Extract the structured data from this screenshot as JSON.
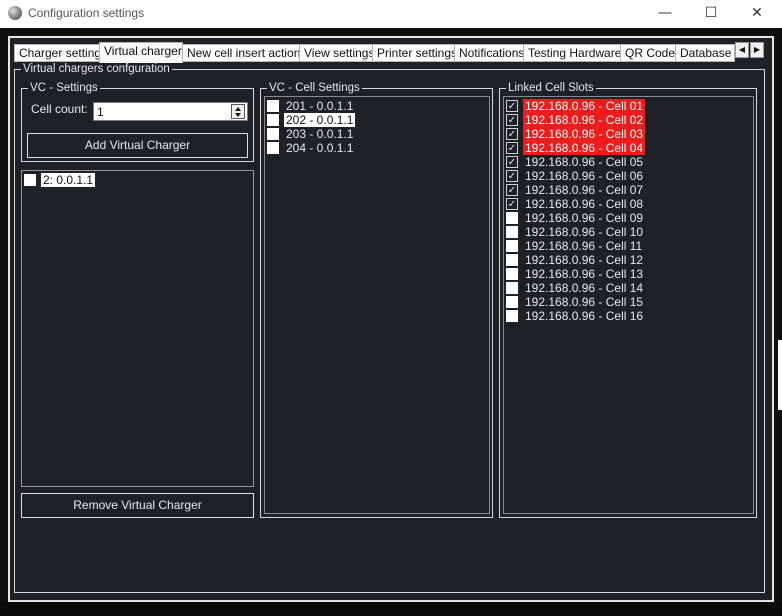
{
  "window": {
    "title": "Configuration settings",
    "min_glyph": "—",
    "max_glyph": "☐",
    "close_glyph": "✕"
  },
  "tabs": [
    {
      "label": "Charger settings",
      "active": false
    },
    {
      "label": "Virtual charger",
      "active": true
    },
    {
      "label": "New cell insert actions",
      "active": false
    },
    {
      "label": "View settings",
      "active": false
    },
    {
      "label": "Printer settings",
      "active": false
    },
    {
      "label": "Notifications",
      "active": false
    },
    {
      "label": "Testing Hardware",
      "active": false
    },
    {
      "label": "QR Code",
      "active": false
    },
    {
      "label": "Database S",
      "active": false
    }
  ],
  "tab_scroll": {
    "left": "◀",
    "right": "▶"
  },
  "config_group": {
    "title": "Virtual chargers confguration"
  },
  "vc_settings": {
    "title": "VC - Settings",
    "cell_count_label": "Cell count:",
    "cell_count_value": "1",
    "add_button": "Add Virtual Charger"
  },
  "vc_list": [
    {
      "label": "2: 0.0.1.1",
      "checked": false,
      "highlight": true
    }
  ],
  "remove_button": "Remove Virtual Charger",
  "cell_settings": {
    "title": "VC - Cell Settings",
    "items": [
      {
        "label": "201 - 0.0.1.1",
        "checked": false,
        "highlight": false
      },
      {
        "label": "202 - 0.0.1.1",
        "checked": false,
        "highlight": true
      },
      {
        "label": "203 - 0.0.1.1",
        "checked": false,
        "highlight": false
      },
      {
        "label": "204 - 0.0.1.1",
        "checked": false,
        "highlight": false
      }
    ]
  },
  "linked_slots": {
    "title": "Linked Cell Slots",
    "items": [
      {
        "label": "192.168.0.96 - Cell 01",
        "checked": true,
        "red": true
      },
      {
        "label": "192.168.0.96 - Cell 02",
        "checked": true,
        "red": true
      },
      {
        "label": "192.168.0.96 - Cell 03",
        "checked": true,
        "red": true
      },
      {
        "label": "192.168.0.96 - Cell 04",
        "checked": true,
        "red": true
      },
      {
        "label": "192.168.0.96 - Cell 05",
        "checked": true,
        "red": false
      },
      {
        "label": "192.168.0.96 - Cell 06",
        "checked": true,
        "red": false
      },
      {
        "label": "192.168.0.96 - Cell 07",
        "checked": true,
        "red": false
      },
      {
        "label": "192.168.0.96 - Cell 08",
        "checked": true,
        "red": false
      },
      {
        "label": "192.168.0.96 - Cell 09",
        "checked": false,
        "red": false
      },
      {
        "label": "192.168.0.96 - Cell 10",
        "checked": false,
        "red": false
      },
      {
        "label": "192.168.0.96 - Cell 11",
        "checked": false,
        "red": false
      },
      {
        "label": "192.168.0.96 - Cell 12",
        "checked": false,
        "red": false
      },
      {
        "label": "192.168.0.96 - Cell 13",
        "checked": false,
        "red": false
      },
      {
        "label": "192.168.0.96 - Cell 14",
        "checked": false,
        "red": false
      },
      {
        "label": "192.168.0.96 - Cell 15",
        "checked": false,
        "red": false
      },
      {
        "label": "192.168.0.96 - Cell 16",
        "checked": false,
        "red": false
      }
    ]
  },
  "colors": {
    "panel_bg": "#1e2126",
    "red_highlight": "#ee1c1c",
    "selection": "#ffffff"
  }
}
